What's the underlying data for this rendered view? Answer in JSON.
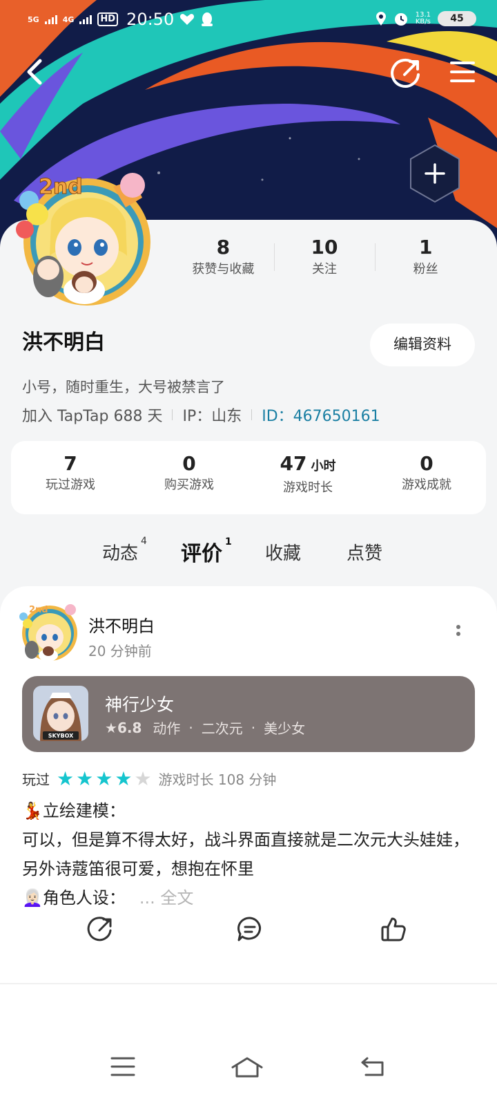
{
  "status_bar": {
    "network1": "5G",
    "network2": "4G",
    "hd": "HD",
    "time": "20:50",
    "speed_value": "13.1",
    "speed_unit": "KB/s",
    "battery": "45"
  },
  "colors": {
    "accent": "#15c5ce",
    "id_link": "#1a7fa3",
    "game_card_bg": "#7d7473",
    "star_on": "#15c5ce",
    "star_off": "#d6d6d6"
  },
  "profile": {
    "stats_top": [
      {
        "value": "8",
        "label": "获赞与收藏"
      },
      {
        "value": "10",
        "label": "关注"
      },
      {
        "value": "1",
        "label": "粉丝"
      }
    ],
    "name": "洪不明白",
    "edit_button": "编辑资料",
    "bio": "小号，随时重生，大号被禁言了",
    "join_text": "加入 TapTap 688 天",
    "ip_text": "IP：山东",
    "id_text": "ID：467650161"
  },
  "game_stats": [
    {
      "value": "7",
      "unit": "",
      "label": "玩过游戏"
    },
    {
      "value": "0",
      "unit": "",
      "label": "购买游戏"
    },
    {
      "value": "47",
      "unit": "小时",
      "label": "游戏时长"
    },
    {
      "value": "0",
      "unit": "",
      "label": "游戏成就"
    }
  ],
  "tabs": [
    {
      "label": "动态",
      "count": "4"
    },
    {
      "label": "评价",
      "count": "1",
      "active": true
    },
    {
      "label": "收藏",
      "count": ""
    },
    {
      "label": "点赞",
      "count": ""
    }
  ],
  "review": {
    "author": "洪不明白",
    "time": "20 分钟前",
    "game": {
      "title": "神行少女",
      "icon_label": "SKYBOX",
      "rating": "6.8",
      "tags": [
        "动作",
        "二次元",
        "美少女"
      ]
    },
    "played_label": "玩过",
    "stars": 4,
    "stars_max": 5,
    "playtime": "游戏时长 108 分钟",
    "line1": "💃立绘建模：",
    "line2": "可以，但是算不得太好，战斗界面直接就是二次元大头娃娃，另外诗蔻笛很可爱，想抱在怀里",
    "line3": "👩🏻‍🦳角色人设：",
    "more": "... 全文"
  }
}
